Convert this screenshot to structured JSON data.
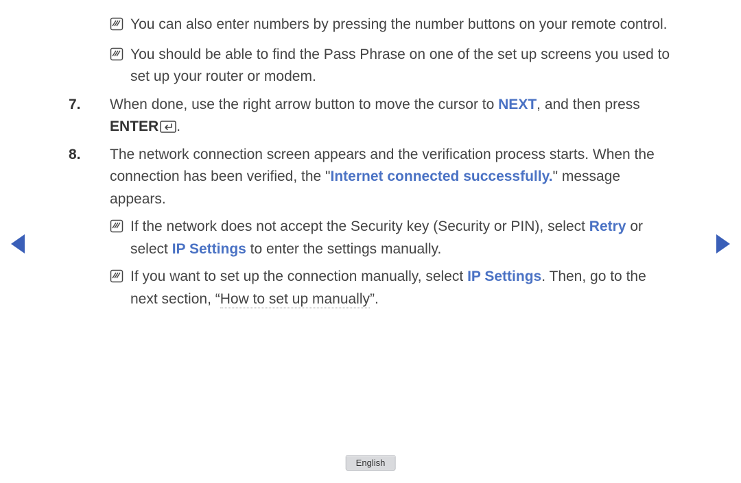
{
  "notes_top": [
    "You can also enter numbers by pressing the number buttons on your remote control.",
    "You should be able to find the Pass Phrase on one of the set up screens you used to set up your router or modem."
  ],
  "step7": {
    "num": "7.",
    "pre": "When done, use the right arrow button to move the cursor to ",
    "next": "NEXT",
    "mid": ", and then press ",
    "enter": "ENTER",
    "post": "."
  },
  "step8": {
    "num": "8.",
    "pre": "The network connection screen appears and the verification process starts. When the connection has been verified, the \"",
    "msg": "Internet connected successfully.",
    "post": "\" message appears."
  },
  "note_retry": {
    "pre": "If the network does not accept the Security key (Security or PIN), select ",
    "retry": "Retry",
    "mid": " or select ",
    "ip": "IP Settings",
    "post": " to enter the settings manually."
  },
  "note_manual": {
    "pre": "If you want to set up the connection manually, select ",
    "ip": "IP Settings",
    "mid": ". Then, go to the next section, “",
    "link": "How to set up manually",
    "post": "”."
  },
  "language": "English"
}
